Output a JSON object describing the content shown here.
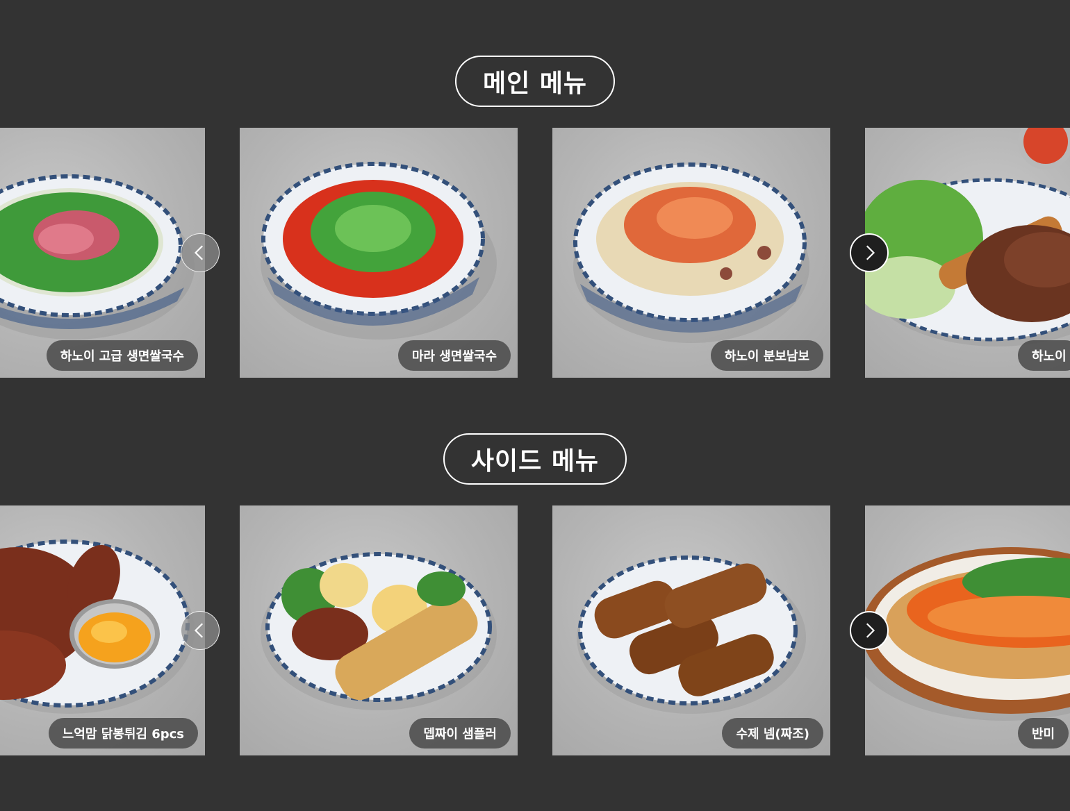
{
  "sections": {
    "main": {
      "title": "메인 메뉴",
      "items": [
        {
          "label": "하노이 고급 생면쌀국수",
          "dish": "beef-pho-bowl"
        },
        {
          "label": "마라 생면쌀국수",
          "dish": "mala-noodle-bowl"
        },
        {
          "label": "하노이 분보남보",
          "dish": "bun-bo-nam-bo-bowl"
        },
        {
          "label": "하노이",
          "dish": "grilled-pork-plate"
        }
      ]
    },
    "side": {
      "title": "사이드 메뉴",
      "items": [
        {
          "label": "느억맘 닭봉튀김 6pcs",
          "dish": "fried-chicken-wings"
        },
        {
          "label": "뎁짜이 샘플러",
          "dish": "sampler-plate"
        },
        {
          "label": "수제 넴(짜조)",
          "dish": "fried-spring-rolls"
        },
        {
          "label": "반미",
          "dish": "banh-mi-basket"
        }
      ]
    }
  },
  "nav": {
    "prev_icon": "chevron-left-icon",
    "next_icon": "chevron-right-icon"
  },
  "colors": {
    "background": "#333333",
    "text": "#ffffff",
    "label_bg": "rgba(70,70,70,0.82)"
  }
}
